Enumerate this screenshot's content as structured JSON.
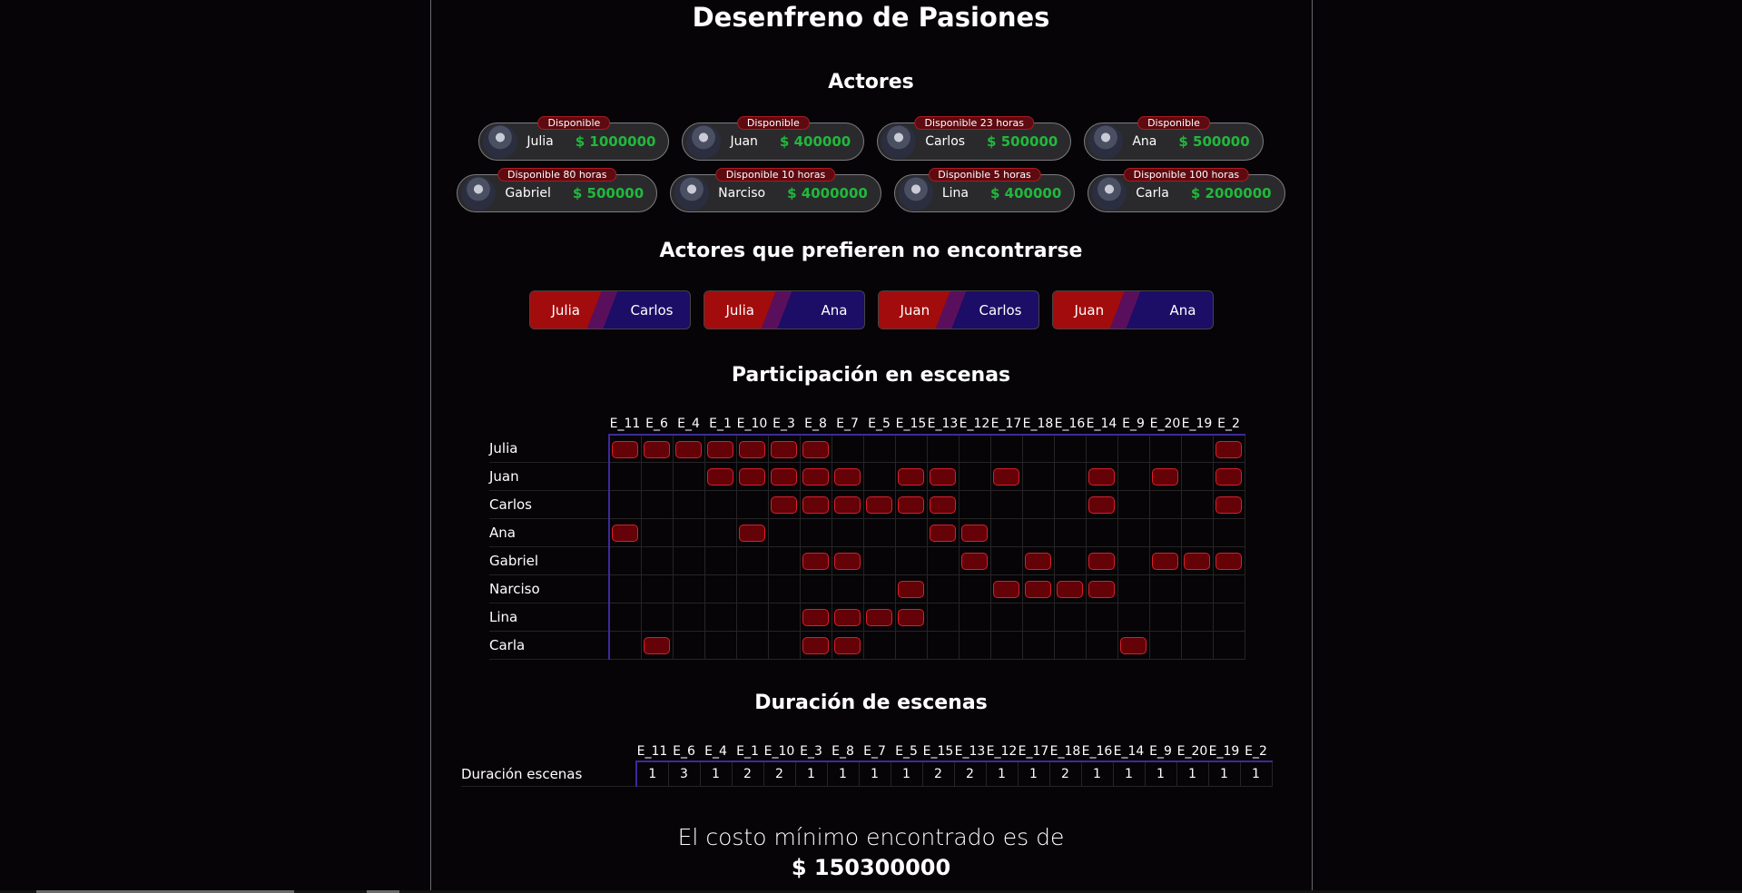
{
  "page_title": "Desenfreno de Pasiones",
  "sections": {
    "actors_title": "Actores",
    "conflicts_title": "Actores que prefieren no encontrarse",
    "participation_title": "Participación en escenas",
    "duration_title": "Duración de escenas"
  },
  "actors_row1": [
    {
      "name": "Julia",
      "cost": "$ 1000000",
      "availability": "Disponible"
    },
    {
      "name": "Juan",
      "cost": "$ 400000",
      "availability": "Disponible"
    },
    {
      "name": "Carlos",
      "cost": "$ 500000",
      "availability": "Disponible 23 horas"
    },
    {
      "name": "Ana",
      "cost": "$ 500000",
      "availability": "Disponible"
    }
  ],
  "actors_row2": [
    {
      "name": "Gabriel",
      "cost": "$ 500000",
      "availability": "Disponible 80 horas"
    },
    {
      "name": "Narciso",
      "cost": "$ 4000000",
      "availability": "Disponible 10 horas"
    },
    {
      "name": "Lina",
      "cost": "$ 400000",
      "availability": "Disponible 5 horas"
    },
    {
      "name": "Carla",
      "cost": "$ 2000000",
      "availability": "Disponible 100 horas"
    }
  ],
  "conflicts": [
    {
      "a": "Julia",
      "b": "Carlos"
    },
    {
      "a": "Julia",
      "b": "Ana"
    },
    {
      "a": "Juan",
      "b": "Carlos"
    },
    {
      "a": "Juan",
      "b": "Ana"
    }
  ],
  "scenes": [
    "E_11",
    "E_6",
    "E_4",
    "E_1",
    "E_10",
    "E_3",
    "E_8",
    "E_7",
    "E_5",
    "E_15",
    "E_13",
    "E_12",
    "E_17",
    "E_18",
    "E_16",
    "E_14",
    "E_9",
    "E_20",
    "E_19",
    "E_2"
  ],
  "participation": [
    {
      "actor": "Julia",
      "cells": [
        1,
        1,
        1,
        1,
        1,
        1,
        1,
        0,
        0,
        0,
        0,
        0,
        0,
        0,
        0,
        0,
        0,
        0,
        0,
        1
      ]
    },
    {
      "actor": "Juan",
      "cells": [
        0,
        0,
        0,
        1,
        1,
        1,
        1,
        1,
        0,
        1,
        1,
        0,
        1,
        0,
        0,
        1,
        0,
        1,
        0,
        1
      ]
    },
    {
      "actor": "Carlos",
      "cells": [
        0,
        0,
        0,
        0,
        0,
        1,
        1,
        1,
        1,
        1,
        1,
        0,
        0,
        0,
        0,
        1,
        0,
        0,
        0,
        1
      ]
    },
    {
      "actor": "Ana",
      "cells": [
        1,
        0,
        0,
        0,
        1,
        0,
        0,
        0,
        0,
        0,
        1,
        1,
        0,
        0,
        0,
        0,
        0,
        0,
        0,
        0
      ]
    },
    {
      "actor": "Gabriel",
      "cells": [
        0,
        0,
        0,
        0,
        0,
        0,
        1,
        1,
        0,
        0,
        0,
        1,
        0,
        1,
        0,
        1,
        0,
        1,
        1,
        1
      ]
    },
    {
      "actor": "Narciso",
      "cells": [
        0,
        0,
        0,
        0,
        0,
        0,
        0,
        0,
        0,
        1,
        0,
        0,
        1,
        1,
        1,
        1,
        0,
        0,
        0,
        0
      ]
    },
    {
      "actor": "Lina",
      "cells": [
        0,
        0,
        0,
        0,
        0,
        0,
        1,
        1,
        1,
        1,
        0,
        0,
        0,
        0,
        0,
        0,
        0,
        0,
        0,
        0
      ]
    },
    {
      "actor": "Carla",
      "cells": [
        0,
        1,
        0,
        0,
        0,
        0,
        1,
        1,
        0,
        0,
        0,
        0,
        0,
        0,
        0,
        0,
        1,
        0,
        0,
        0
      ]
    }
  ],
  "duration": {
    "row_label": "Duración escenas",
    "values": [
      "1",
      "3",
      "1",
      "2",
      "2",
      "1",
      "1",
      "1",
      "1",
      "2",
      "2",
      "1",
      "1",
      "2",
      "1",
      "1",
      "1",
      "1",
      "1",
      "1"
    ]
  },
  "result": {
    "label": "El costo mínimo encontrado es de",
    "value": "$ 150300000"
  }
}
